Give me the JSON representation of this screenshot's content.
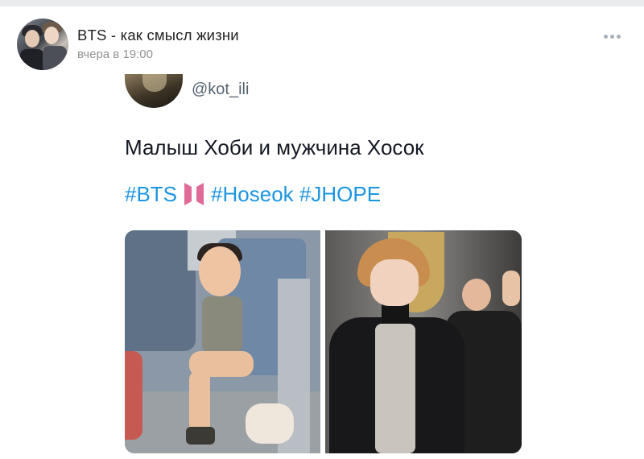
{
  "post": {
    "group_name": "BTS - как смысл жизни",
    "time": "вчера в 19:00",
    "more_icon": "more-horizontal-icon"
  },
  "tweet": {
    "handle": "@kot_ili",
    "text": "Малыш Хоби и мужчина Хосок",
    "hashtags": [
      "#BTS",
      "#Hoseok",
      "#JHOPE"
    ],
    "hashtag_color": "#1b95e0",
    "logo_icon": "bts-logo-icon",
    "logo_color": "#e06a98"
  },
  "colors": {
    "group_name": "#222222",
    "meta": "#939393",
    "tweet_text": "#141823"
  }
}
